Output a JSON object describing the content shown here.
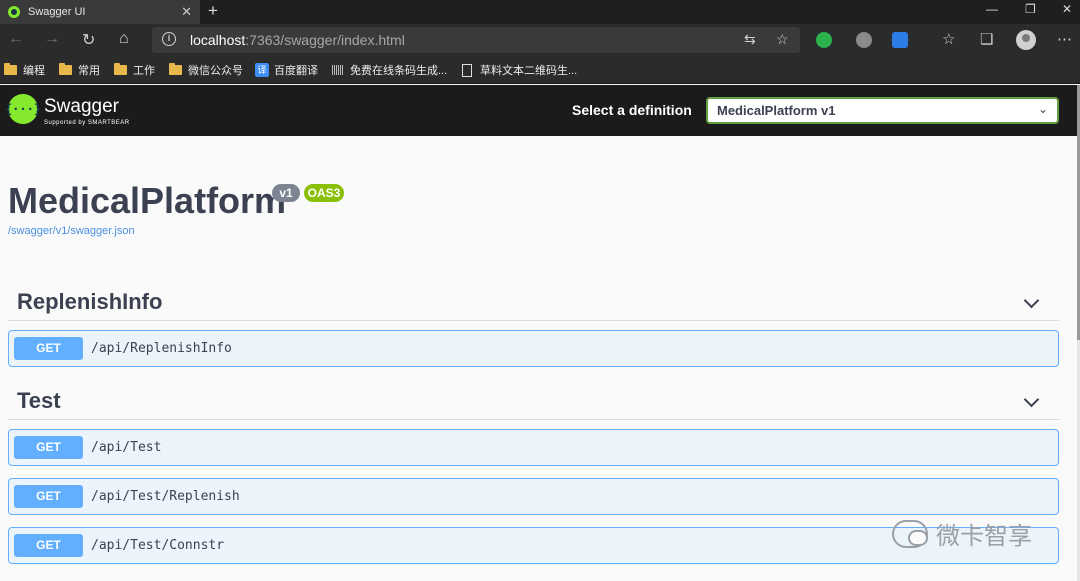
{
  "browser": {
    "tab_title": "Swagger UI",
    "new_tab": "+",
    "url_host": "localhost",
    "url_rest": ":7363/swagger/index.html",
    "bookmarks": [
      {
        "label": "编程",
        "icon": "folder-icon"
      },
      {
        "label": "常用",
        "icon": "folder-icon"
      },
      {
        "label": "工作",
        "icon": "folder-icon"
      },
      {
        "label": "微信公众号",
        "icon": "folder-icon"
      },
      {
        "label": "百度翻译",
        "icon": "translate-icon"
      },
      {
        "label": "免费在线条码生成...",
        "icon": "barcode-icon"
      },
      {
        "label": "草料文本二维码生...",
        "icon": "document-icon"
      }
    ]
  },
  "swagger": {
    "brand": "Swagger",
    "brand_sub": "Supported by SMARTBEAR",
    "logo_glyph": "{···}",
    "select_label": "Select a definition",
    "selected_definition": "MedicalPlatform v1",
    "title": "MedicalPlatform",
    "version_badge": "v1",
    "oas_badge": "OAS3",
    "spec_url": "/swagger/v1/swagger.json",
    "colors": {
      "get": "#61affe",
      "get_bg": "#ebf3fb",
      "accent": "#85ea2d",
      "select_border": "#62a03f"
    },
    "sections": [
      {
        "name": "ReplenishInfo",
        "operations": [
          {
            "method": "GET",
            "path": "/api/ReplenishInfo"
          }
        ]
      },
      {
        "name": "Test",
        "operations": [
          {
            "method": "GET",
            "path": "/api/Test"
          },
          {
            "method": "GET",
            "path": "/api/Test/Replenish"
          },
          {
            "method": "GET",
            "path": "/api/Test/Connstr"
          }
        ]
      }
    ]
  },
  "watermark": "微卡智享"
}
